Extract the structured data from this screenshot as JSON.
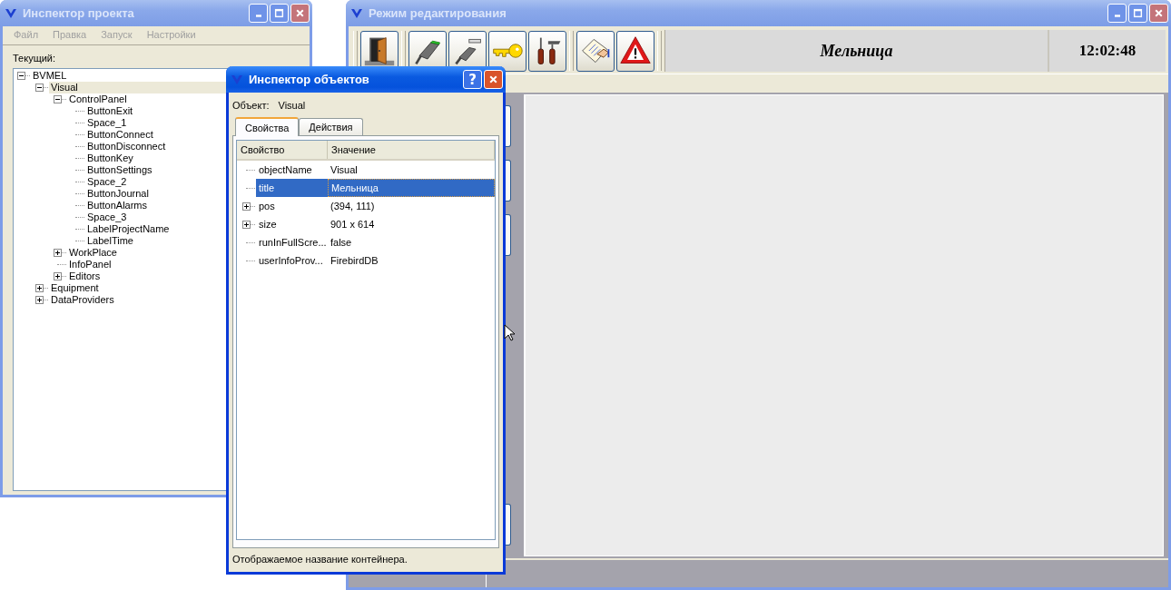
{
  "project_inspector": {
    "title": "Инспектор проекта",
    "active": false,
    "menu": [
      {
        "label": "Файл",
        "disabled": true
      },
      {
        "label": "Правка",
        "disabled": true
      },
      {
        "label": "Запуск",
        "disabled": true
      },
      {
        "label": "Настройки",
        "disabled": true
      }
    ],
    "current_label": "Текущий:",
    "tree": [
      {
        "label": "BVMEL",
        "expanded": true,
        "selected": false,
        "children": [
          {
            "label": "Visual",
            "expanded": true,
            "selected": true,
            "children": [
              {
                "label": "ControlPanel",
                "expanded": true,
                "selected": false,
                "children": [
                  {
                    "label": "ButtonExit",
                    "selected": false
                  },
                  {
                    "label": "Space_1",
                    "selected": false
                  },
                  {
                    "label": "ButtonConnect",
                    "selected": false
                  },
                  {
                    "label": "ButtonDisconnect",
                    "selected": false
                  },
                  {
                    "label": "ButtonKey",
                    "selected": false
                  },
                  {
                    "label": "ButtonSettings",
                    "selected": false
                  },
                  {
                    "label": "Space_2",
                    "selected": false
                  },
                  {
                    "label": "ButtonJournal",
                    "selected": false
                  },
                  {
                    "label": "ButtonAlarms",
                    "selected": false
                  },
                  {
                    "label": "Space_3",
                    "selected": false
                  },
                  {
                    "label": "LabelProjectName",
                    "selected": false
                  },
                  {
                    "label": "LabelTime",
                    "selected": false
                  }
                ]
              },
              {
                "label": "WorkPlace",
                "expanded": false,
                "selected": false
              },
              {
                "label": "InfoPanel",
                "selected": false
              },
              {
                "label": "Editors",
                "expanded": false,
                "selected": false
              }
            ]
          },
          {
            "label": "Equipment",
            "expanded": false,
            "selected": false
          },
          {
            "label": "DataProviders",
            "expanded": false,
            "selected": false
          }
        ]
      }
    ]
  },
  "edit_window": {
    "title": "Режим редактирования",
    "active": false,
    "toolbar_groups": [
      [
        {
          "kind": "exit"
        }
      ],
      [
        {
          "kind": "connect"
        },
        {
          "kind": "disconnect"
        },
        {
          "kind": "key"
        },
        {
          "kind": "settings"
        }
      ],
      [
        {
          "kind": "journal"
        },
        {
          "kind": "alarms"
        }
      ]
    ],
    "project_name": "Мельница",
    "time": "12:02:48"
  },
  "object_inspector": {
    "title": "Инспектор объектов",
    "active": true,
    "help_button": "?",
    "object_label": "Объект:",
    "object_name": "Visual",
    "tabs": [
      {
        "label": "Свойства",
        "selected": true
      },
      {
        "label": "Действия",
        "selected": false
      }
    ],
    "columns": [
      "Свойство",
      "Значение"
    ],
    "rows": [
      {
        "name": "objectName",
        "value": "Visual",
        "selected": false
      },
      {
        "name": "title",
        "value": "Мельница",
        "selected": true
      },
      {
        "name": "pos",
        "value": "(394, 111)",
        "selected": false,
        "expanded": false
      },
      {
        "name": "size",
        "value": "901 x 614",
        "selected": false,
        "expanded": false
      },
      {
        "name": "runInFullScre...",
        "value": "false",
        "selected": false
      },
      {
        "name": "userInfoProv...",
        "value": "FirebirdDB",
        "selected": false
      }
    ],
    "description": "Отображаемое название контейнера."
  }
}
